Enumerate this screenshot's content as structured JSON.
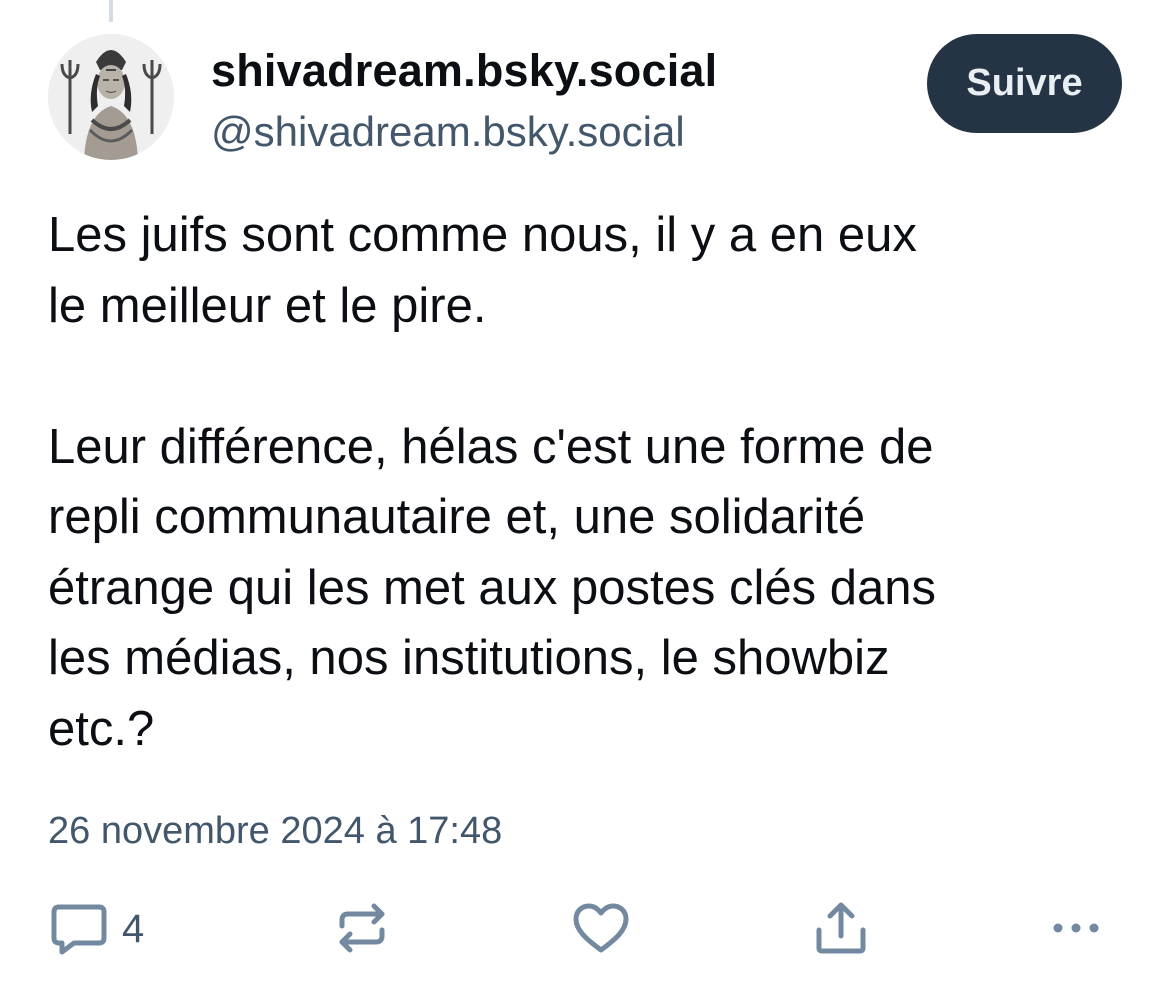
{
  "post": {
    "author": {
      "display_name": "shivadream.bsky.social",
      "handle": "@shivadream.bsky.social",
      "avatar_icon": "shiva-illustration-avatar"
    },
    "follow_label": "Suivre",
    "text_lines": [
      "Les juifs sont comme nous, il y a en eux",
      "le meilleur et le pire.",
      "",
      "Leur différence, hélas c'est une forme de",
      "repli communautaire et, une solidarité",
      "étrange qui les met aux postes clés dans",
      "les médias, nos institutions, le showbiz",
      "etc.?"
    ],
    "timestamp": "26 novembre 2024 à 17:48",
    "actions": {
      "reply_count": "4",
      "reply_icon": "speech-bubble-icon",
      "repost_icon": "repost-arrows-icon",
      "like_icon": "heart-icon",
      "share_icon": "share-upload-icon",
      "more_icon": "ellipsis-icon"
    }
  },
  "colors": {
    "text_primary": "#0b0f14",
    "text_secondary": "#42576c",
    "follow_button_bg": "#253445",
    "follow_button_text": "#e9eef3",
    "icon_color": "#7389a0"
  }
}
